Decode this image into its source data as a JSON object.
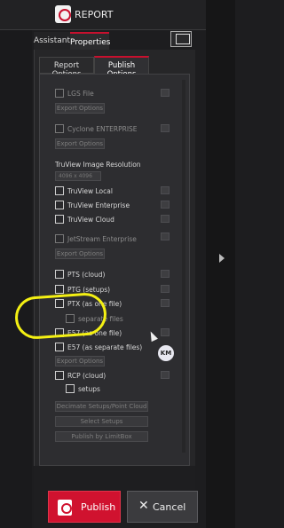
{
  "header": {
    "title": "REPORT"
  },
  "tabs": [
    {
      "label": "Assistant"
    },
    {
      "label": "Properties"
    }
  ],
  "subtabs": [
    {
      "label": "Report Options"
    },
    {
      "label": "Publish Options"
    }
  ],
  "options": {
    "lgs": {
      "label": "LGS File",
      "export_label": "Export Options"
    },
    "cyclone": {
      "label": "Cyclone ENTERPRISE",
      "export_label": "Export Options"
    },
    "truview_res": {
      "label": "TruView Image Resolution",
      "select_value": "4096 x 4096"
    },
    "truview_local": {
      "label": "TruView Local"
    },
    "truview_enterprise": {
      "label": "TruView Enterprise"
    },
    "truview_cloud": {
      "label": "TruView Cloud"
    },
    "jetstream": {
      "label": "JetStream Enterprise",
      "export_label": "Export Options"
    },
    "pts": {
      "label": "PTS (cloud)"
    },
    "ptg": {
      "label": "PTG (setups)"
    },
    "ptx": {
      "label": "PTX (as one file)"
    },
    "ptx_sep": {
      "label": "separate files"
    },
    "e57_one": {
      "label": "E57 (as one file)"
    },
    "e57_sep": {
      "label": "E57 (as separate files)",
      "export_label": "Export Options"
    },
    "rcp": {
      "label": "RCP (cloud)"
    },
    "rcp_setups": {
      "label": "setups"
    },
    "decimate": {
      "label": "Decimate Setups/Point Cloud"
    },
    "select_setups": {
      "label": "Select Setups"
    },
    "publish_limitbox": {
      "label": "Publish by LimitBox"
    }
  },
  "annotation": {
    "badge": "KM",
    "highlight_color": "#f4f013"
  },
  "footer": {
    "publish_label": "Publish",
    "cancel_label": "Cancel",
    "accent": "#d0122f"
  }
}
